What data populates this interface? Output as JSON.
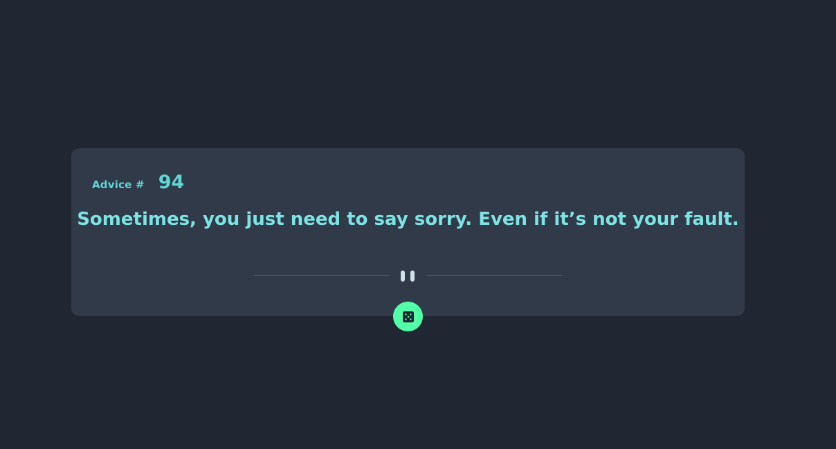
{
  "advice": {
    "label": "Advice #",
    "number": "94",
    "text": "Sometimes, you just need to say sorry. Even if it’s not your fault."
  },
  "divider": {
    "icon": "pause-icon"
  },
  "button": {
    "icon": "dice-icon"
  },
  "colors": {
    "background": "#202632",
    "card": "#313A49",
    "accent": "#52FFA8",
    "text": "#7ee3e3",
    "divider": "#4E5D73"
  }
}
